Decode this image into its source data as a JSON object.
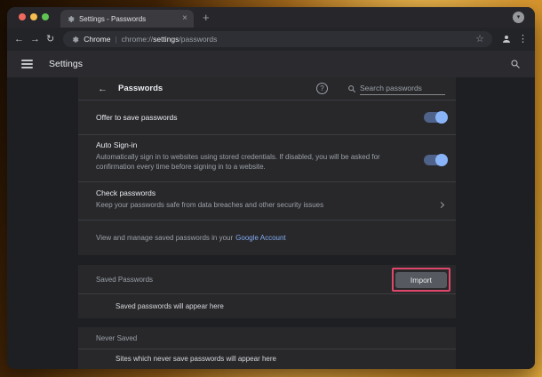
{
  "chrome": {
    "tab": {
      "title": "Settings - Passwords",
      "close_glyph": "×",
      "new_tab_glyph": "+",
      "tab_search_glyph": "▾"
    },
    "toolbar": {
      "back_glyph": "←",
      "forward_glyph": "→",
      "reload_glyph": "↻",
      "site_name": "Chrome",
      "divider_glyph": "|",
      "url_scheme": "chrome://",
      "url_host": "settings",
      "url_path": "/passwords",
      "star_glyph": "☆",
      "menu_glyph": "⋮"
    }
  },
  "settings": {
    "header_title": "Settings",
    "page_title": "Passwords",
    "back_glyph": "←",
    "help_glyph": "?",
    "search_placeholder": "Search passwords",
    "rows": {
      "offer_to_save": {
        "label": "Offer to save passwords",
        "toggle_state": "on"
      },
      "auto_sign_in": {
        "label": "Auto Sign-in",
        "description": "Automatically sign in to websites using stored credentials. If disabled, you will be asked for confirmation every time before signing in to a website.",
        "toggle_state": "on"
      },
      "check_passwords": {
        "label": "Check passwords",
        "description": "Keep your passwords safe from data breaches and other security issues"
      },
      "manage": {
        "text": "View and manage saved passwords in your",
        "link_label": "Google Account"
      }
    },
    "saved_passwords": {
      "label": "Saved Passwords",
      "import_button_label": "Import",
      "empty_text": "Saved passwords will appear here"
    },
    "never_saved": {
      "label": "Never Saved",
      "empty_text": "Sites which never save passwords will appear here"
    }
  },
  "colors": {
    "traffic_red": "#ee6a5f",
    "traffic_yellow": "#f5bd4f",
    "traffic_green": "#61c354",
    "toggle_track": "#4f6289",
    "toggle_thumb": "#8ab4f8",
    "link": "#82abf0",
    "annotation_highlight": "#e0486b"
  }
}
